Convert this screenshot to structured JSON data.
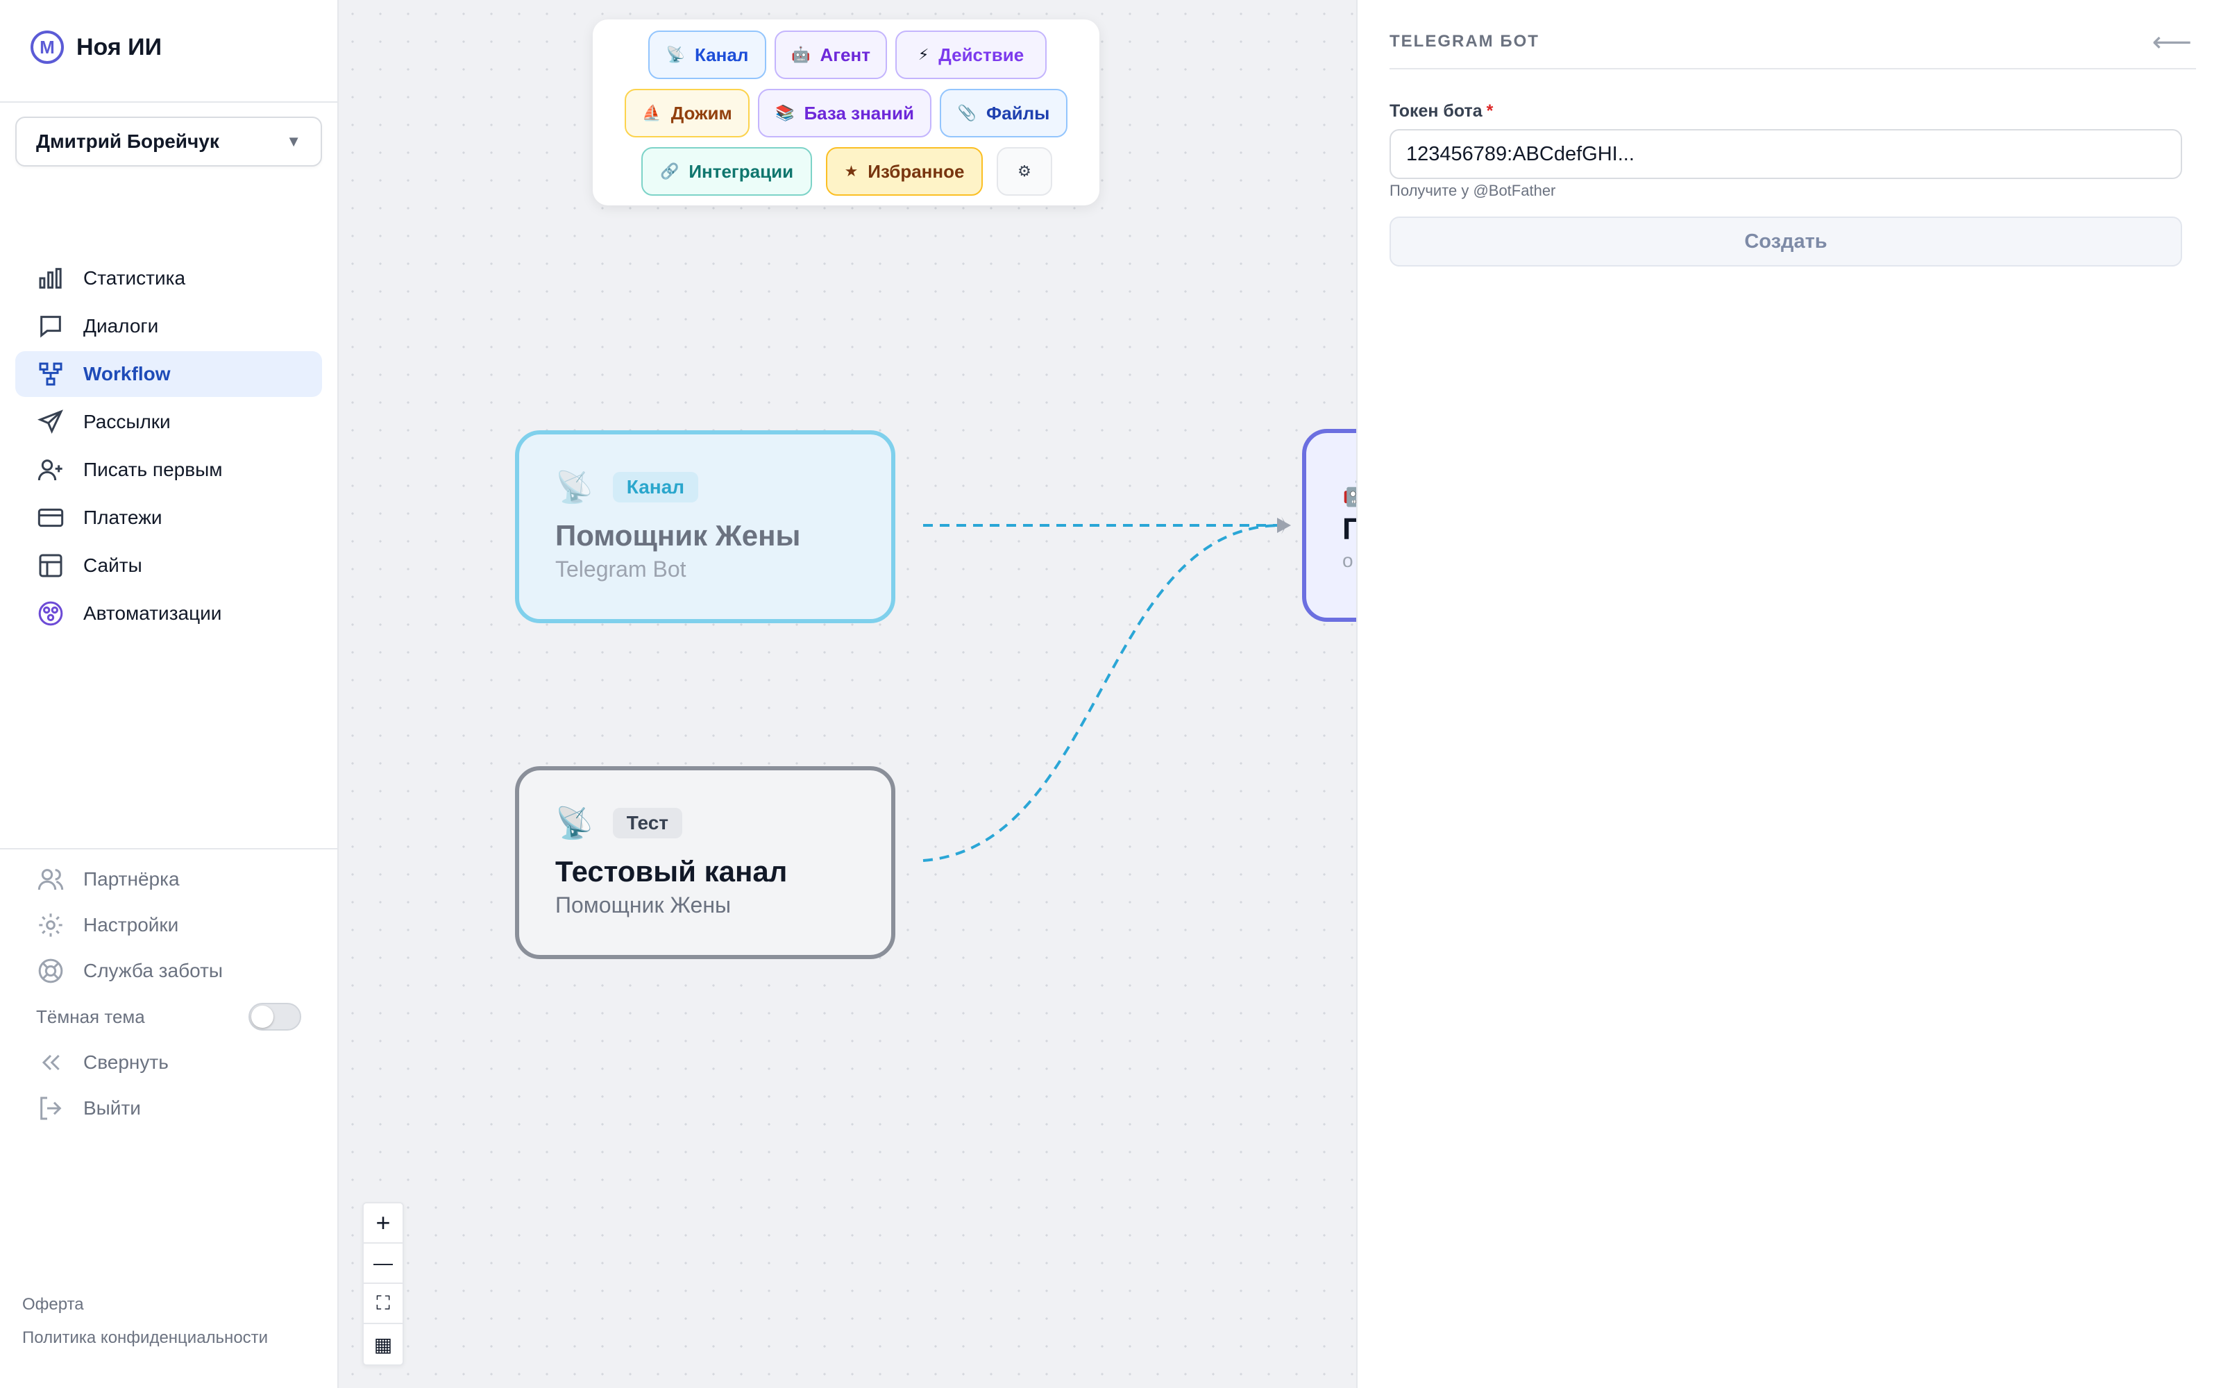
{
  "brand": {
    "title": "Ноя ИИ",
    "logo": "М"
  },
  "user": {
    "name": "Дмитрий Борейчук",
    "caret": "▼"
  },
  "nav": {
    "items": [
      {
        "label": "Статистика",
        "icon": "bar-chart-icon"
      },
      {
        "label": "Диалоги",
        "icon": "chat-bubble-icon"
      },
      {
        "label": "Workflow",
        "icon": "workflow-icon",
        "active": true
      },
      {
        "label": "Рассылки",
        "icon": "send-icon"
      },
      {
        "label": "Писать первым",
        "icon": "user-plus-icon"
      },
      {
        "label": "Платежи",
        "icon": "credit-card-icon"
      },
      {
        "label": "Сайты",
        "icon": "layout-icon"
      },
      {
        "label": "Автоматизации",
        "icon": "automation-icon"
      }
    ]
  },
  "bottom_nav": {
    "partner": "Партнёрка",
    "settings": "Настройки",
    "support": "Служба заботы",
    "dark_theme": "Тёмная тема",
    "collapse": "Свернуть",
    "logout": "Выйти"
  },
  "footer": {
    "offer": "Оферта",
    "privacy": "Политика конфиденциальности"
  },
  "palette": {
    "chips": [
      {
        "label": "Канал",
        "icon": "📡",
        "color": "#1d4ed8"
      },
      {
        "label": "Агент",
        "icon": "🤖",
        "color": "#6d28d9"
      },
      {
        "label": "Действие",
        "icon": "⚡",
        "color": "#7c3aed"
      },
      {
        "label": "Дожим",
        "icon": "⛵",
        "color": "#92400e"
      },
      {
        "label": "База знаний",
        "icon": "📚",
        "color": "#6d28d9"
      },
      {
        "label": "Файлы",
        "icon": "📎",
        "color": "#1e40af"
      },
      {
        "label": "Интеграции",
        "icon": "🔗",
        "color": "#0f766e"
      },
      {
        "label": "Избранное",
        "icon": "★",
        "color": "#78350f"
      }
    ],
    "settings_icon": "⚙"
  },
  "nodes": [
    {
      "tag": "Канал",
      "title": "Помощник Жены",
      "subtitle": "Telegram Bot",
      "icon": "📡"
    },
    {
      "tag": "Тест",
      "title": "Тестовый канал",
      "subtitle": "Помощник Жены",
      "icon": "📡"
    },
    {
      "title": "П",
      "subtitle": "о",
      "icon": "🤖"
    }
  ],
  "zoom_controls": {
    "zoom_in": "+",
    "zoom_out": "—",
    "fit": "⛶",
    "layout": "▦"
  },
  "panel": {
    "title": "TELEGRAM БОТ",
    "back": "⟵",
    "token_label": "Токен бота",
    "required_mark": "*",
    "token_value": "123456789:ABCdefGHI...",
    "hint": "Получите у @BotFather",
    "create_label": "Создать"
  },
  "colors": {
    "accent": "#1e4bb8",
    "edge": "#2aa6d6",
    "agent_border": "#6b6fe0"
  }
}
